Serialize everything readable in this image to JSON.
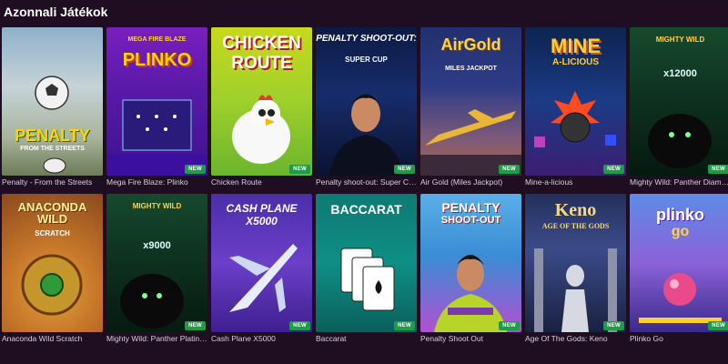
{
  "section": {
    "title": "Azonnali Játékok"
  },
  "badge_label": "NEW",
  "games": [
    {
      "caption": "Penalty - From the Streets",
      "art_title": "PENALTY",
      "art_sub": "FROM THE STREETS",
      "new": false
    },
    {
      "caption": "Mega Fire Blaze: Plinko",
      "art_title": "PLINKO",
      "art_sub": "MEGA FIRE BLAZE",
      "new": true
    },
    {
      "caption": "Chicken Route",
      "art_title": "CHICKEN",
      "art_sub": "ROUTE",
      "new": true
    },
    {
      "caption": "Penalty shoot-out: Super Cup",
      "art_title": "PENALTY SHOOT-OUT:",
      "art_sub": "SUPER CUP",
      "new": true
    },
    {
      "caption": "Air Gold (Miles Jackpot)",
      "art_title": "AirGold",
      "art_sub": "MILES JACKPOT",
      "new": true
    },
    {
      "caption": "Mine-a-licious",
      "art_title": "MINE",
      "art_sub": "A-LICIOUS",
      "new": true
    },
    {
      "caption": "Mighty Wild: Panther Diamond",
      "art_title": "MIGHTY WILD",
      "art_sub": "x12000",
      "new": true
    },
    {
      "caption": "Anaconda Wild Scratch",
      "art_title": "ANACONDA WILD",
      "art_sub": "SCRATCH",
      "new": false
    },
    {
      "caption": "Mighty Wild: Panther Platinum",
      "art_title": "MIGHTY WILD",
      "art_sub": "x9000",
      "new": true
    },
    {
      "caption": "Cash Plane X5000",
      "art_title": "CASH PLANE",
      "art_sub": "X5000",
      "new": true
    },
    {
      "caption": "Baccarat",
      "art_title": "BACCARAT",
      "art_sub": "",
      "new": true
    },
    {
      "caption": "Penalty Shoot Out",
      "art_title": "PENALTY",
      "art_sub": "SHOOT-OUT",
      "new": true
    },
    {
      "caption": "Age Of The Gods: Keno",
      "art_title": "Keno",
      "art_sub": "AGE OF THE GODS",
      "new": true
    },
    {
      "caption": "Plinko Go",
      "art_title": "plinko",
      "art_sub": "go",
      "new": true
    }
  ],
  "colors": {
    "page_bg": "#1f0d22",
    "badge_bg": "#1e9c4a",
    "caption_text": "#d8d0dc"
  }
}
